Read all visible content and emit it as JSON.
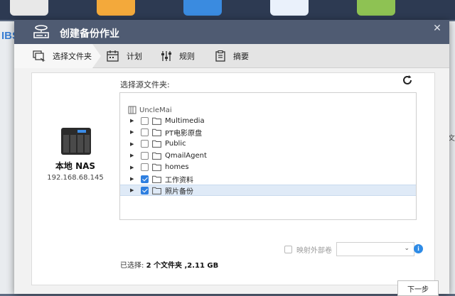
{
  "background": {
    "left_text": "IBS",
    "right_text": "文"
  },
  "dialog": {
    "title": "创建备份作业",
    "title_icon": "backup-drive-icon",
    "close_icon": "close-icon",
    "header_color": "#4f5b72"
  },
  "steps": [
    {
      "label": "选择文件夹",
      "icon": "folders-icon",
      "active": true
    },
    {
      "label": "计划",
      "icon": "calendar-icon",
      "active": false
    },
    {
      "label": "规则",
      "icon": "sliders-icon",
      "active": false
    },
    {
      "label": "摘要",
      "icon": "clipboard-icon",
      "active": false
    }
  ],
  "nas": {
    "name": "本地 NAS",
    "ip": "192.168.68.145"
  },
  "source": {
    "label": "选择源文件夹:",
    "root": "UncleMai",
    "folders": [
      {
        "name": "Multimedia",
        "checked": false
      },
      {
        "name": "PT电影原盘",
        "checked": false
      },
      {
        "name": "Public",
        "checked": false
      },
      {
        "name": "QmailAgent",
        "checked": false
      },
      {
        "name": "homes",
        "checked": false
      },
      {
        "name": "工作资料",
        "checked": true
      },
      {
        "name": "照片备份",
        "checked": true,
        "selected": true
      }
    ]
  },
  "mapping": {
    "label": "映射外部卷",
    "value": ""
  },
  "selection": {
    "prefix": "已选择:",
    "value": "2 个文件夹 ,2.11 GB"
  },
  "buttons": {
    "next": "下一步"
  },
  "colors": {
    "accent": "#2e7fe0",
    "selected_row": "#dfeaf7"
  }
}
